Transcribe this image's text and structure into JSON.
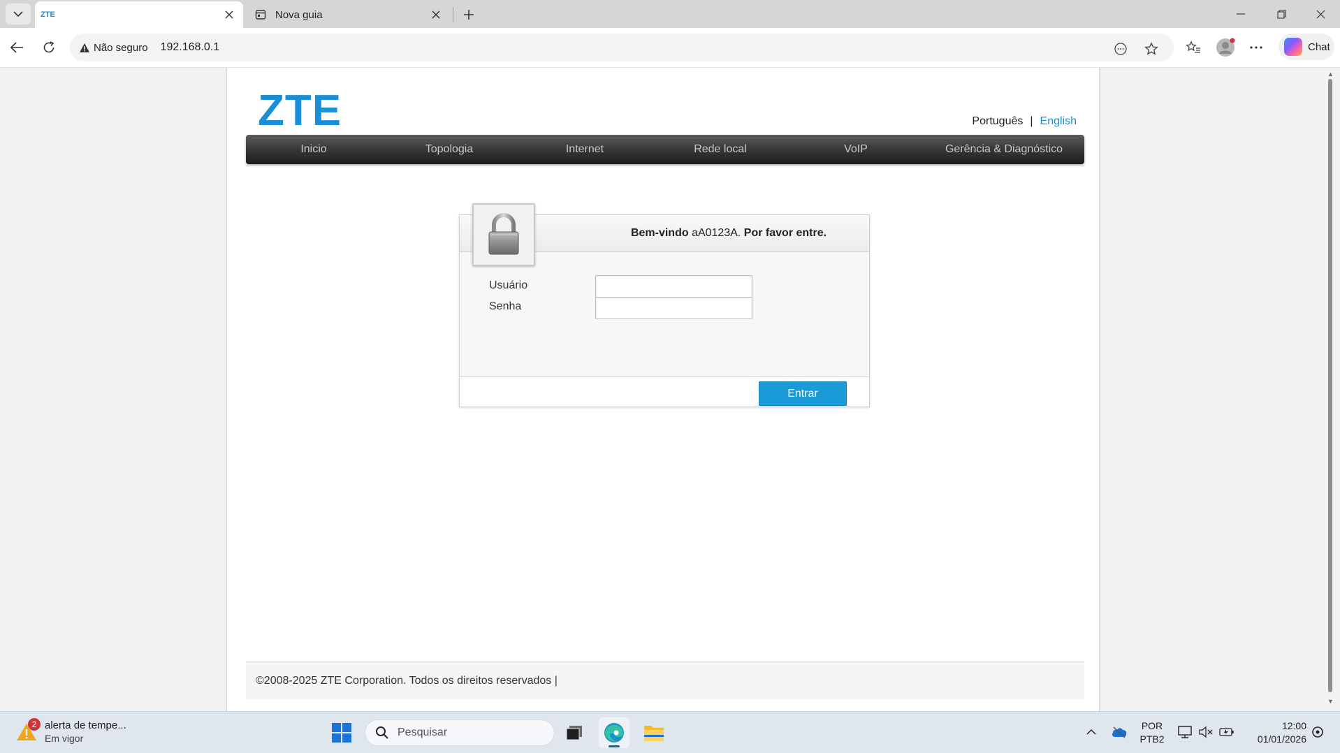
{
  "browser": {
    "tabs": [
      {
        "title": "ZTE",
        "active": true
      },
      {
        "title": "Nova guia",
        "active": false
      }
    ],
    "address": {
      "security_label": "Não seguro",
      "url": "192.168.0.1"
    },
    "chat_label": "Chat"
  },
  "page": {
    "logo": "ZTE",
    "languages": {
      "portuguese": "Português",
      "separator": "|",
      "english": "English"
    },
    "nav": [
      "Inicio",
      "Topologia",
      "Internet",
      "Rede local",
      "VoIP",
      "Gerência & Diagnóstico"
    ],
    "login": {
      "welcome_prefix": "Bem-vindo",
      "model": "aA0123A.",
      "welcome_suffix": "Por favor entre.",
      "username_label": "Usuário",
      "username_value": "",
      "password_label": "Senha",
      "password_value": "",
      "submit_label": "Entrar"
    },
    "footer": "©2008-2025 ZTE Corporation. Todos os direitos reservados  |"
  },
  "taskbar": {
    "weather": {
      "badge": "2",
      "title": "alerta de tempe...",
      "subtitle": "Em vigor"
    },
    "search_placeholder": "Pesquisar",
    "language": {
      "line1": "POR",
      "line2": "PTB2"
    },
    "clock": {
      "time": "12:00",
      "date": "01/01/2026"
    }
  },
  "colors": {
    "brand": "#1a8fd5",
    "button": "#1a9bd7",
    "nav_bg": "#2e2e2e"
  }
}
